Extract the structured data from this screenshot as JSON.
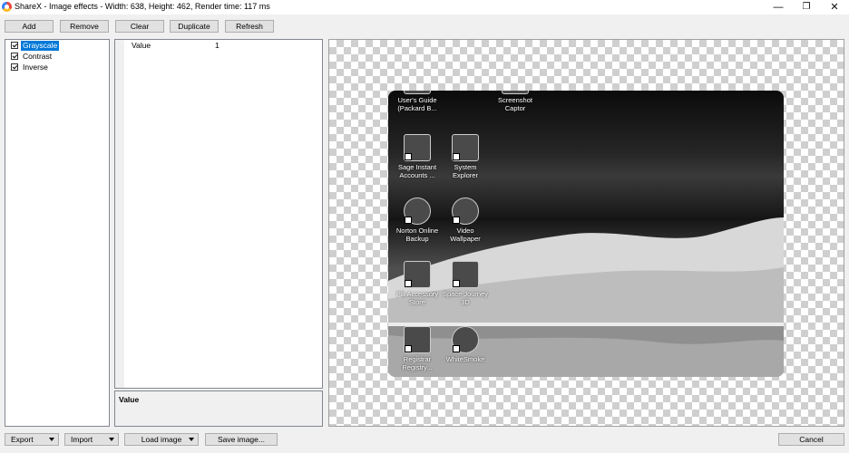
{
  "window": {
    "title": "ShareX - Image effects - Width: 638, Height: 462, Render time: 117 ms",
    "minimize": "—",
    "maximize": "❐",
    "close": "✕"
  },
  "toolbar": {
    "add": "Add",
    "remove": "Remove",
    "clear": "Clear",
    "duplicate": "Duplicate",
    "refresh": "Refresh"
  },
  "effects": [
    {
      "label": "Grayscale",
      "checked": true,
      "selected": true
    },
    {
      "label": "Contrast",
      "checked": true,
      "selected": false
    },
    {
      "label": "Inverse",
      "checked": true,
      "selected": false
    }
  ],
  "properties": {
    "rows": [
      {
        "name": "Value",
        "value": "1"
      }
    ],
    "description_title": "Value"
  },
  "preview": {
    "icons": [
      {
        "label": "User's Guide\n(Packard B..."
      },
      {
        "label": "Screenshot\nCaptor"
      },
      {
        "label": "Sage Instant\nAccounts ..."
      },
      {
        "label": "System\nExplorer"
      },
      {
        "label": "Norton Online\nBackup"
      },
      {
        "label": "Video\nWallpaper"
      },
      {
        "label": "PB Accessory\nStore"
      },
      {
        "label": "Space Journey\n3D"
      },
      {
        "label": "Registrar\nRegistry..."
      },
      {
        "label": "WhiteSmoke"
      }
    ]
  },
  "footer": {
    "export": "Export",
    "import": "Import",
    "load_image": "Load image",
    "save_image": "Save image...",
    "cancel": "Cancel"
  },
  "colors": {
    "selection": "#0078d7",
    "window_bg": "#f0f0f0"
  }
}
